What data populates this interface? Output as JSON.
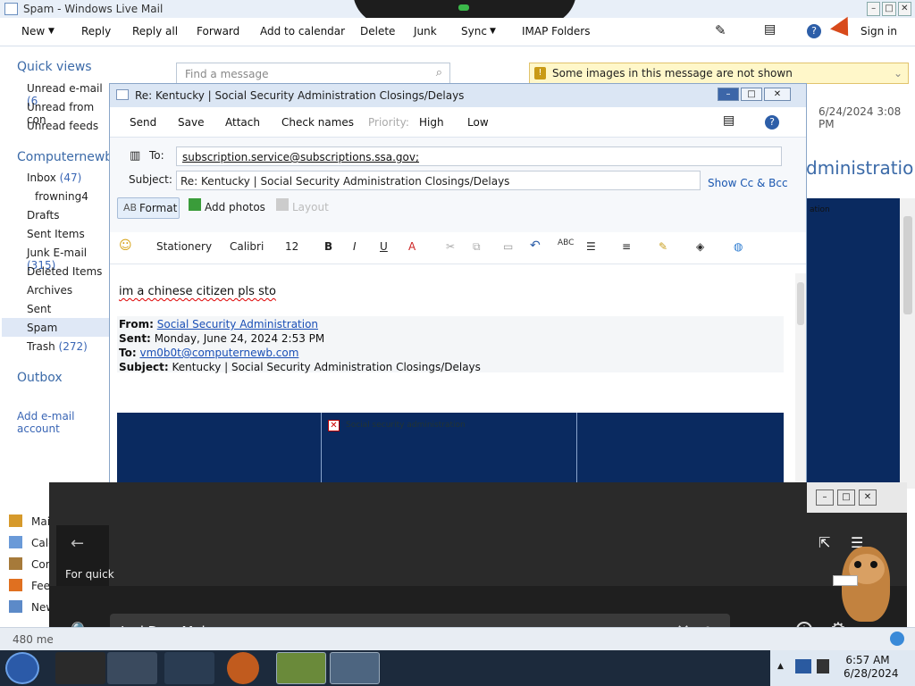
{
  "main_window": {
    "title": "Spam - Windows Live Mail",
    "ribbon": [
      "New",
      "Reply",
      "Reply all",
      "Forward",
      "Add to calendar",
      "Delete",
      "Junk",
      "Sync",
      "IMAP Folders"
    ],
    "sign_in": "Sign in"
  },
  "sidebar": {
    "quick_views": "Quick views",
    "quick_items": [
      {
        "label": "Unread e-mail",
        "count": "(6"
      },
      {
        "label": "Unread from con",
        "count": ""
      },
      {
        "label": "Unread feeds",
        "count": ""
      }
    ],
    "account": "Computernewb",
    "folders": [
      {
        "label": "Inbox",
        "count": "(47)"
      },
      {
        "label": "frowning4",
        "count": ""
      },
      {
        "label": "Drafts",
        "count": ""
      },
      {
        "label": "Sent Items",
        "count": ""
      },
      {
        "label": "Junk E-mail",
        "count": "(315)"
      },
      {
        "label": "Deleted Items",
        "count": ""
      },
      {
        "label": "Archives",
        "count": ""
      },
      {
        "label": "Sent",
        "count": ""
      },
      {
        "label": "Spam",
        "count": ""
      },
      {
        "label": "Trash",
        "count": "(272)"
      }
    ],
    "outbox": "Outbox",
    "add_account": "Add e-mail account",
    "bottom_nav": [
      "Mai",
      "Cale",
      "Cor",
      "Fee",
      "New"
    ]
  },
  "search": {
    "placeholder": "Find a message"
  },
  "reading": {
    "warning": "Some images in this message are not shown",
    "date": "6/24/2024 3:08 PM",
    "title_fragment": "dministration C",
    "body_fragment": "ation"
  },
  "compose": {
    "title": "Re: Kentucky | Social Security Administration Closings/Delays",
    "toolbar": {
      "send": "Send",
      "save": "Save",
      "attach": "Attach",
      "check_names": "Check names",
      "priority": "Priority:",
      "high": "High",
      "low": "Low"
    },
    "to_label": "To:",
    "to_value": "subscription.service@subscriptions.ssa.gov;",
    "subject_label": "Subject:",
    "subject_value": "Re: Kentucky | Social Security Administration Closings/Delays",
    "show_cc": "Show Cc & Bcc",
    "format": "Format",
    "add_photos": "Add photos",
    "layout": "Layout",
    "formatting": {
      "stationery": "Stationery",
      "font": "Calibri",
      "size": "12"
    },
    "typed": "im a chinese citizen pls sto",
    "quote": {
      "from_label": "From:",
      "from_value": "Social Security Administration",
      "sent_label": "Sent:",
      "sent_value": "Monday, June 24, 2024 2:53 PM",
      "to_label": "To:",
      "to_value": "vm0b0t@computernewb.com",
      "subject_label": "Subject:",
      "subject_value": "Kentucky | Social Security Administration Closings/Delays"
    },
    "image_alt": "Social security administration"
  },
  "overlay": {
    "for_quick": "For quick",
    "search_text": "JackDoesMalwares"
  },
  "status": {
    "text": "480 me"
  },
  "clock": {
    "time": "6:57 AM",
    "date": "6/28/2024"
  },
  "colors": {
    "accent": "#3b6aa8",
    "banner": "#0a2a60",
    "taskbar": "#1c2a3c"
  }
}
